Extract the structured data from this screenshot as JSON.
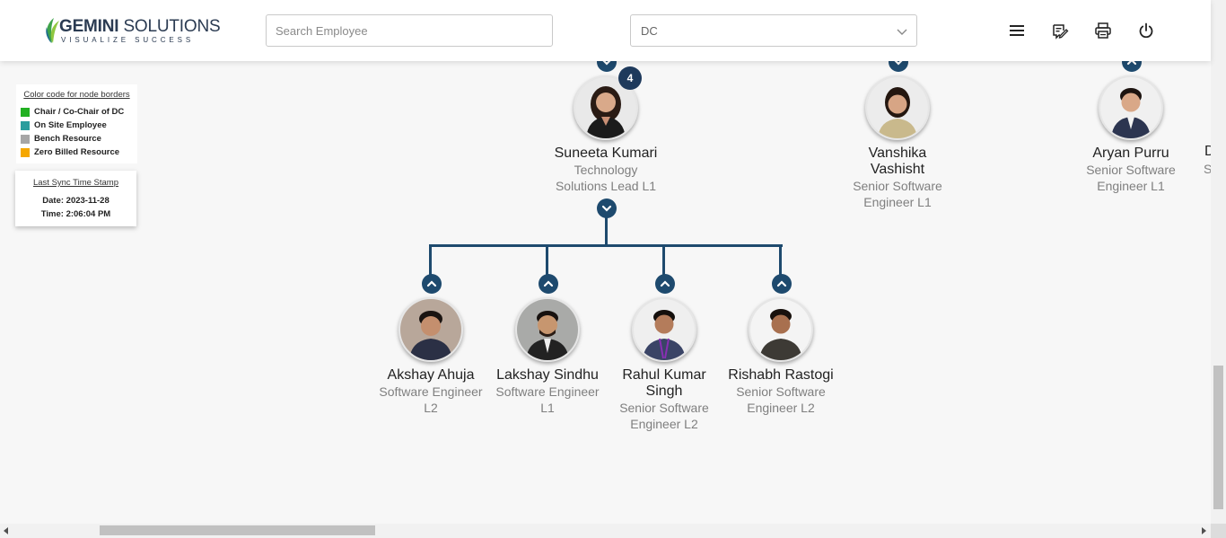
{
  "brand": {
    "name_bold": "GEMINI",
    "name_rest": " SOLUTIONS",
    "tagline": "VISUALIZE SUCCESS",
    "leaf_colors": [
      "#3ea34a",
      "#8fc740",
      "#1f6e8c"
    ]
  },
  "search": {
    "placeholder": "Search Employee",
    "value": ""
  },
  "dc_select": {
    "value": "DC"
  },
  "toolbar": {
    "icons": [
      "menu-icon",
      "edit-icon",
      "print-icon",
      "power-icon"
    ]
  },
  "legend": {
    "title": "Color code for node borders",
    "items": [
      {
        "label": "Chair / Co-Chair of DC",
        "color": "#22b022"
      },
      {
        "label": "On Site Employee",
        "color": "#2a9d9d"
      },
      {
        "label": "Bench Resource",
        "color": "#a6a6a6"
      },
      {
        "label": "Zero Billed Resource",
        "color": "#f5a700"
      }
    ]
  },
  "sync": {
    "title": "Last Sync Time Stamp",
    "date": "Date: 2023-11-28",
    "time": "Time: 2:06:04 PM"
  },
  "chart": {
    "top_nodes": [
      {
        "name": "Suneeta Kumari",
        "role": "Technology Solutions Lead L1",
        "role_lines": [
          "Technology",
          "Solutions Lead L1"
        ],
        "reports": "4"
      },
      {
        "name": "Vanshika Vashisht",
        "name_lines": [
          "Vanshika",
          "Vashisht"
        ],
        "role_lines": [
          "Senior Software",
          "Engineer L1"
        ]
      },
      {
        "name": "Aryan Purru",
        "role_lines": [
          "Senior Software",
          "Engineer L1"
        ]
      },
      {
        "name_partial": "D",
        "role_partial": "S"
      }
    ],
    "children": [
      {
        "name_lines": [
          "Akshay Ahuja"
        ],
        "role_lines": [
          "Software Engineer",
          "L2"
        ]
      },
      {
        "name_lines": [
          "Lakshay Sindhu"
        ],
        "role_lines": [
          "Software Engineer",
          "L1"
        ]
      },
      {
        "name_lines": [
          "Rahul Kumar",
          "Singh"
        ],
        "role_lines": [
          "Senior Software",
          "Engineer L2"
        ]
      },
      {
        "name_lines": [
          "Rishabh Rastogi"
        ],
        "role_lines": [
          "Senior Software",
          "Engineer L2"
        ]
      }
    ]
  }
}
